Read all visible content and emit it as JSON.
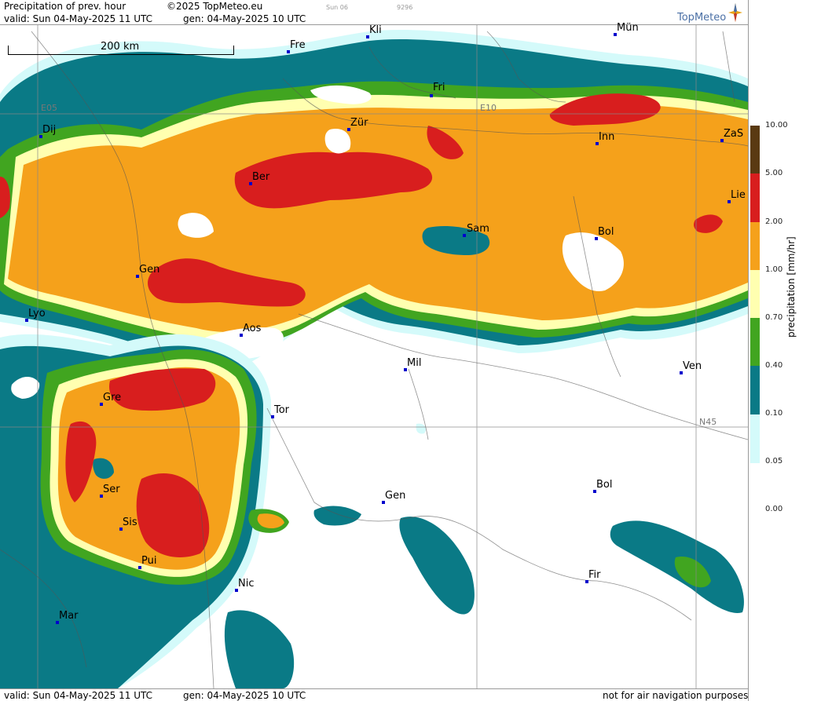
{
  "header": {
    "title": "Precipitation of prev. hour",
    "copyright": "©2025 TopMeteo.eu",
    "valid": "valid:  Sun  04-May-2025  11 UTC",
    "gen": "gen: 04-May-2025 10 UTC",
    "next": "Sun 06",
    "code": "9296",
    "logo": "TopMeteo"
  },
  "footer": {
    "valid": "valid:  Sun  04-May-2025  11 UTC",
    "gen": "gen: 04-May-2025 10 UTC",
    "note": "not for air navigation purposes"
  },
  "scale_label": "200 km",
  "grid_labels": {
    "e05": "E05",
    "e10": "E10",
    "n45": "N45"
  },
  "cities": [
    {
      "name": "Kli"
    },
    {
      "name": "Mün"
    },
    {
      "name": "Fre"
    },
    {
      "name": "Fri"
    },
    {
      "name": "Dij"
    },
    {
      "name": "Zür"
    },
    {
      "name": "Inn"
    },
    {
      "name": "ZaS"
    },
    {
      "name": "Ber"
    },
    {
      "name": "Lie"
    },
    {
      "name": "Sam"
    },
    {
      "name": "Bol"
    },
    {
      "name": "Gen"
    },
    {
      "name": "Lyo"
    },
    {
      "name": "Aos"
    },
    {
      "name": "Mil"
    },
    {
      "name": "Ven"
    },
    {
      "name": "Gre"
    },
    {
      "name": "Tor"
    },
    {
      "name": "Ser"
    },
    {
      "name": "Gen"
    },
    {
      "name": "Bol"
    },
    {
      "name": "Sis"
    },
    {
      "name": "Pui"
    },
    {
      "name": "Nic"
    },
    {
      "name": "Fir"
    },
    {
      "name": "Mar"
    }
  ],
  "legend": {
    "unit": "precipitation  [mm/hr]",
    "levels": [
      "10.00",
      "5.00",
      "2.00",
      "1.00",
      "0.70",
      "0.40",
      "0.10",
      "0.05",
      "0.00"
    ],
    "colors": [
      "#5a3a12",
      "#d81e1e",
      "#f5a11b",
      "#ffffb0",
      "#41a520",
      "#0a7a86",
      "#d4fafa",
      "#ffffff"
    ]
  }
}
